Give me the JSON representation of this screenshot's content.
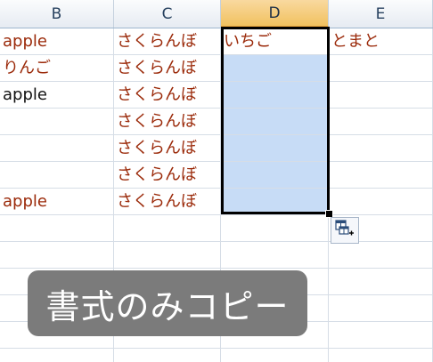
{
  "columns": [
    "B",
    "C",
    "D",
    "E"
  ],
  "selected_column": "D",
  "rows": [
    [
      {
        "text": "apple",
        "color": "#9b2a0a"
      },
      {
        "text": "さくらんぼ",
        "color": "#9b2a0a"
      },
      {
        "text": "いちご",
        "color": "#9b2a0a"
      },
      {
        "text": "とまと",
        "color": "#9b2a0a"
      }
    ],
    [
      {
        "text": "りんご",
        "color": "#9b2a0a"
      },
      {
        "text": "さくらんぼ",
        "color": "#9b2a0a"
      },
      {
        "text": "",
        "color": "#9b2a0a"
      },
      {
        "text": "",
        "color": "#9b2a0a"
      }
    ],
    [
      {
        "text": "apple",
        "color": "#111111"
      },
      {
        "text": "さくらんぼ",
        "color": "#9b2a0a"
      },
      {
        "text": "",
        "color": "#9b2a0a"
      },
      {
        "text": "",
        "color": "#9b2a0a"
      }
    ],
    [
      {
        "text": "",
        "color": "#9b2a0a"
      },
      {
        "text": "さくらんぼ",
        "color": "#9b2a0a"
      },
      {
        "text": "",
        "color": "#9b2a0a"
      },
      {
        "text": "",
        "color": "#9b2a0a"
      }
    ],
    [
      {
        "text": "",
        "color": "#9b2a0a"
      },
      {
        "text": "さくらんぼ",
        "color": "#9b2a0a"
      },
      {
        "text": "",
        "color": "#9b2a0a"
      },
      {
        "text": "",
        "color": "#9b2a0a"
      }
    ],
    [
      {
        "text": "",
        "color": "#9b2a0a"
      },
      {
        "text": "さくらんぼ",
        "color": "#9b2a0a"
      },
      {
        "text": "",
        "color": "#9b2a0a"
      },
      {
        "text": "",
        "color": "#9b2a0a"
      }
    ],
    [
      {
        "text": "apple",
        "color": "#9b2a0a"
      },
      {
        "text": "さくらんぼ",
        "color": "#9b2a0a"
      },
      {
        "text": "",
        "color": "#9b2a0a"
      },
      {
        "text": "",
        "color": "#9b2a0a"
      }
    ],
    [
      {
        "text": "",
        "color": "#9b2a0a"
      },
      {
        "text": "",
        "color": "#9b2a0a"
      },
      {
        "text": "",
        "color": "#9b2a0a"
      },
      {
        "text": "",
        "color": "#9b2a0a"
      }
    ],
    [
      {
        "text": "",
        "color": "#9b2a0a"
      },
      {
        "text": "",
        "color": "#9b2a0a"
      },
      {
        "text": "",
        "color": "#9b2a0a"
      },
      {
        "text": "",
        "color": "#9b2a0a"
      }
    ],
    [
      {
        "text": "",
        "color": "#9b2a0a"
      },
      {
        "text": "",
        "color": "#9b2a0a"
      },
      {
        "text": "",
        "color": "#9b2a0a"
      },
      {
        "text": "",
        "color": "#9b2a0a"
      }
    ],
    [
      {
        "text": "",
        "color": "#9b2a0a"
      },
      {
        "text": "",
        "color": "#9b2a0a"
      },
      {
        "text": "",
        "color": "#9b2a0a"
      },
      {
        "text": "",
        "color": "#9b2a0a"
      }
    ],
    [
      {
        "text": "",
        "color": "#9b2a0a"
      },
      {
        "text": "",
        "color": "#9b2a0a"
      },
      {
        "text": "",
        "color": "#9b2a0a"
      },
      {
        "text": "",
        "color": "#9b2a0a"
      }
    ],
    [
      {
        "text": "",
        "color": "#9b2a0a"
      },
      {
        "text": "",
        "color": "#9b2a0a"
      },
      {
        "text": "",
        "color": "#9b2a0a"
      },
      {
        "text": "",
        "color": "#9b2a0a"
      }
    ]
  ],
  "paste_options": {
    "icon": "paste-options-icon"
  },
  "caption": {
    "text": "書式のみコピー"
  },
  "theme": {
    "selection_fill": "#c7dcf6",
    "header_selected": "#f1c15f",
    "grid_line": "#d6dde6"
  }
}
